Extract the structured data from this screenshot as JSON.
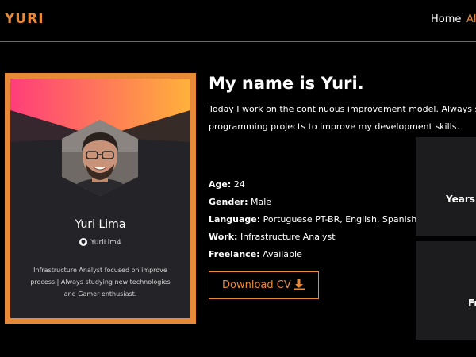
{
  "nav": {
    "logo": "YURI",
    "home": "Home",
    "about_partial": "Al"
  },
  "card": {
    "name": "Yuri Lima",
    "github_handle": "YuriLim4",
    "bio": "Infrastructure Analyst focused on improve process | Always studying new technologies and Gamer enthusiast.",
    "colors": {
      "border": "#e8893a",
      "gradient_start": "#ff3d7a",
      "gradient_end": "#ffb13a",
      "background": "#242428"
    }
  },
  "about": {
    "heading": "My name is Yuri.",
    "intro": "Today I work on the continuous improvement model. Always stu programming projects to improve my development skills.",
    "info": [
      {
        "label": "Age:",
        "value": "24"
      },
      {
        "label": "Gender:",
        "value": "Male"
      },
      {
        "label": "Language:",
        "value": "Portuguese PT-BR, English, Spanish"
      },
      {
        "label": "Work:",
        "value": "Infrastructure Analyst"
      },
      {
        "label": "Freelance:",
        "value": "Available"
      }
    ],
    "download_label": "Download CV"
  },
  "stats": [
    {
      "label": "Years"
    },
    {
      "label": "Fr"
    }
  ],
  "icons": {
    "github": "github-icon",
    "download": "download-icon"
  },
  "accent_color": "#e8893a"
}
